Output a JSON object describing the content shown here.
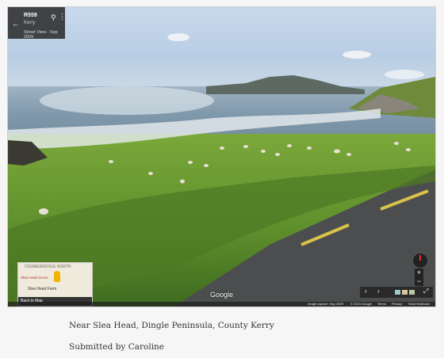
{
  "streetview": {
    "location_title": "R559",
    "region": "Kerry",
    "date_label": "Street View - Sep 2009",
    "back_icon": "arrow-left-icon",
    "pin_icon": "map-pin-icon",
    "more_icon": "more-vert-icon"
  },
  "minimap": {
    "area_label": "COUMEENOOLE NORTH",
    "place_label": "Slea Head Farm",
    "cafe_label": "Slea Head Grove",
    "back_label": "Back to Map"
  },
  "controls": {
    "zoom_in": "+",
    "zoom_out": "−",
    "prev_label": "‹",
    "next_label": "›",
    "expand_label": "⤢"
  },
  "footer": {
    "capture": "Image capture: Sep 2009",
    "copyright": "© 2015 Google",
    "terms": "Terms",
    "privacy": "Privacy",
    "report": "Send feedback"
  },
  "brand": "Google",
  "caption": {
    "location": "Near Slea Head, Dingle Peninsula, County Kerry",
    "submitted": "Submitted by Caroline"
  }
}
